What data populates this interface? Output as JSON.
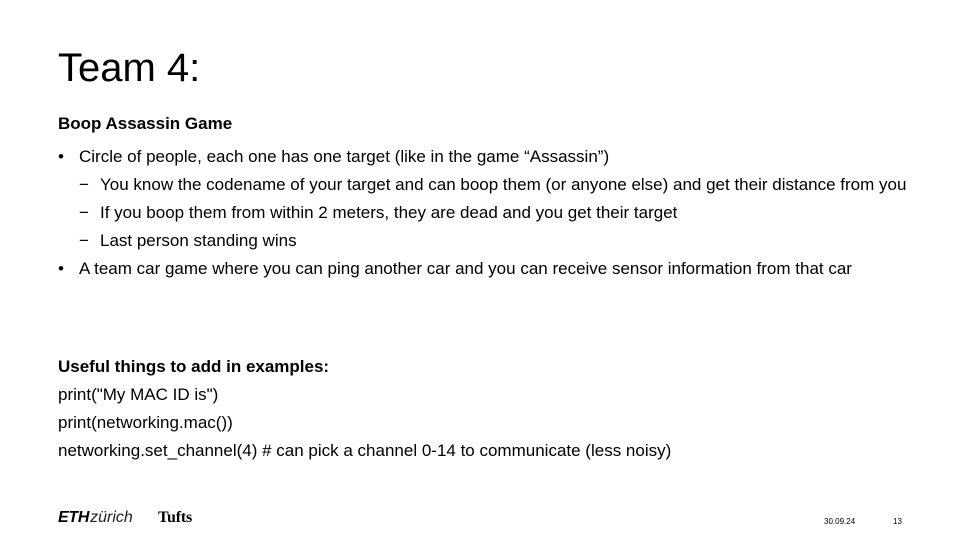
{
  "slide": {
    "title": "Team 4:",
    "subtitle": "Boop Assassin Game",
    "bullets": [
      {
        "marker": "•",
        "text": "Circle of people, each one has one target (like in the game “Assassin”)",
        "subitems": [
          {
            "marker": "−",
            "text": "You know the codename of your target and can boop them (or anyone else) and get their distance from you"
          },
          {
            "marker": "−",
            "text": "If you boop them from within 2 meters, they are dead and you get their target"
          },
          {
            "marker": "−",
            "text": "Last person standing wins"
          }
        ]
      },
      {
        "marker": "•",
        "text": "A team car game where you can ping another car and you can receive sensor information from that car"
      }
    ],
    "useful_heading": "Useful things to add in examples:",
    "code_lines": [
      "print(\"My MAC ID is\")",
      "print(networking.mac())",
      "networking.set_channel(4) # can pick a channel 0-14 to communicate (less noisy)"
    ]
  },
  "footer": {
    "eth_logo_bold": "ETH",
    "eth_logo_rest": "zürich",
    "tufts_logo": "Tufts",
    "date": "30.09.24",
    "page_number": "13"
  }
}
